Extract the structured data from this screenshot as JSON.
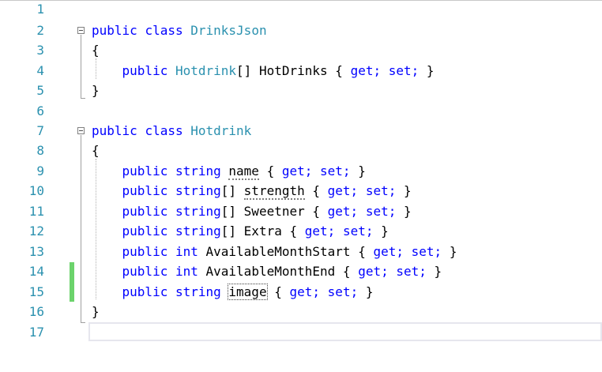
{
  "editor": {
    "line_numbers": [
      "1",
      "2",
      "3",
      "4",
      "5",
      "6",
      "7",
      "8",
      "9",
      "10",
      "11",
      "12",
      "13",
      "14",
      "15",
      "16",
      "17"
    ],
    "tokens": {
      "public": "public",
      "class": "class",
      "string": "string",
      "string_arr": "string",
      "int": "int",
      "brackets": "[]",
      "open_brace": "{",
      "close_brace": "}",
      "get": "get;",
      "set": "set;"
    },
    "class1": {
      "name": "DrinksJson",
      "prop_type": "Hotdrink",
      "prop_name": "HotDrinks"
    },
    "class2": {
      "name": "Hotdrink",
      "props": [
        {
          "name": "name"
        },
        {
          "name": "strength"
        },
        {
          "name": "Sweetner"
        },
        {
          "name": "Extra"
        },
        {
          "name": "AvailableMonthStart"
        },
        {
          "name": "AvailableMonthEnd"
        },
        {
          "name": "image"
        }
      ]
    },
    "colors": {
      "keyword": "#0000ff",
      "type": "#2b91af",
      "line_number": "#2b91af",
      "change_marker": "#6cd36c"
    }
  }
}
